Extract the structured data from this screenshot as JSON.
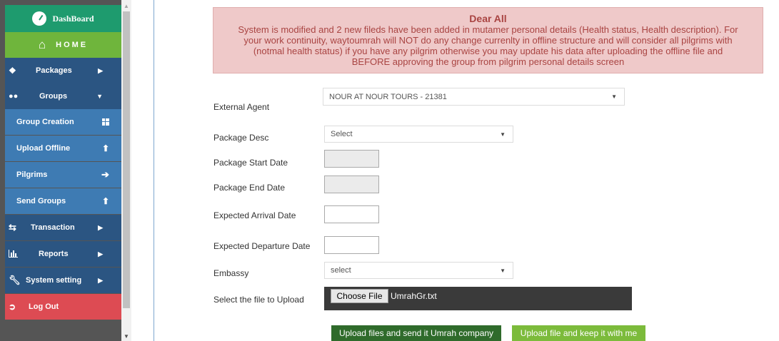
{
  "sidebar": {
    "dashboard": "DashBoard",
    "home": "HOME",
    "items": [
      {
        "label": "Packages"
      },
      {
        "label": "Groups"
      },
      {
        "label": "Group Creation"
      },
      {
        "label": "Upload Offline"
      },
      {
        "label": "Pilgrims"
      },
      {
        "label": "Send Groups"
      },
      {
        "label": "Transaction"
      },
      {
        "label": "Reports"
      },
      {
        "label": "System setting"
      },
      {
        "label": "Log Out"
      }
    ]
  },
  "notice": {
    "title": "Dear All",
    "body": "System is modified and 2 new fileds have been added in mutamer personal details (Health status, Health description). For your work continuity, waytoumrah will NOT do any change currenlty in offline structure and will consider all pilgrims with (notmal health status) if you have any pilgrim otherwise you may update his data after uploading the offline file and BEFORE approving the group from pilgrim personal details screen"
  },
  "form": {
    "external_agent_label": "External Agent",
    "external_agent_value": "NOUR AT NOUR TOURS - 21381",
    "package_desc_label": "Package Desc",
    "package_desc_value": "Select",
    "package_start_label": "Package Start Date",
    "package_end_label": "Package End Date",
    "arrival_label": "Expected Arrival Date",
    "departure_label": "Expected Departure Date",
    "embassy_label": "Embassy",
    "embassy_value": "select",
    "file_label": "Select the file to Upload",
    "choose_file": "Choose File",
    "file_name": "UmrahGr.txt"
  },
  "buttons": {
    "send": "Upload files and send it Umrah company",
    "keep": "Upload file and keep it with me"
  },
  "colors": {
    "sidebar_main": "#2b5582",
    "sidebar_sub": "#3e7bb3",
    "dashboard": "#1e9b6e",
    "home": "#6fb53c",
    "logout": "#dd4b53",
    "notice_bg": "#efc9c9",
    "btn_send": "#2f6b2b",
    "btn_keep": "#7cbb3b"
  }
}
